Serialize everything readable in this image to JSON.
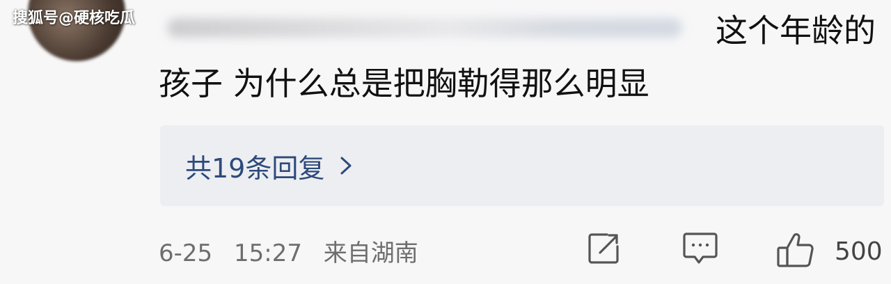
{
  "watermark": "搜狐号@硬核吃瓜",
  "comment": {
    "line1": "这个年龄的",
    "line2": "孩子 为什么总是把胸勒得那么明显"
  },
  "replies": {
    "label": "共19条回复"
  },
  "meta": {
    "date": "6-25",
    "time": "15:27",
    "location": "来自湖南"
  },
  "actions": {
    "like_count": "500",
    "icons": [
      "share-icon",
      "comment-icon",
      "like-icon",
      "chevron-right-icon"
    ]
  },
  "colors": {
    "background": "#f7f7f8",
    "reply_box": "#eceef2",
    "reply_link": "#2d4a7a",
    "meta_text": "#6e6e6e"
  }
}
